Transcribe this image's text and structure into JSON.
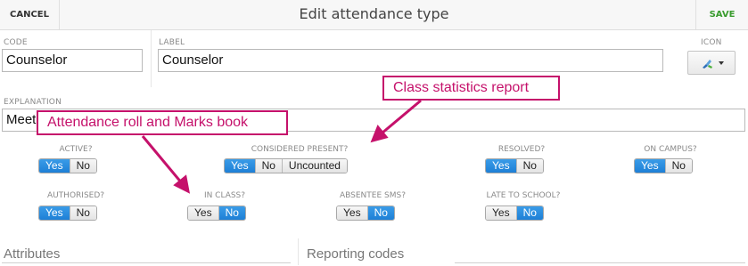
{
  "header": {
    "cancel_label": "CANCEL",
    "title": "Edit attendance type",
    "save_label": "SAVE"
  },
  "form": {
    "code": {
      "label": "CODE",
      "value": "Counselor"
    },
    "label_field": {
      "label": "LABEL",
      "value": "Counselor"
    },
    "icon": {
      "label": "ICON",
      "icon_name": "paint-tool-icon"
    },
    "explanation": {
      "label": "EXPLANATION",
      "value": "Meeti"
    }
  },
  "toggles": {
    "active": {
      "label": "ACTIVE?",
      "options": [
        "Yes",
        "No"
      ],
      "selected": "Yes"
    },
    "considered_present": {
      "label": "CONSIDERED PRESENT?",
      "options": [
        "Yes",
        "No",
        "Uncounted"
      ],
      "selected": "Yes"
    },
    "resolved": {
      "label": "RESOLVED?",
      "options": [
        "Yes",
        "No"
      ],
      "selected": "Yes"
    },
    "on_campus": {
      "label": "ON CAMPUS?",
      "options": [
        "Yes",
        "No"
      ],
      "selected": "Yes"
    },
    "authorised": {
      "label": "AUTHORISED?",
      "options": [
        "Yes",
        "No"
      ],
      "selected": "Yes"
    },
    "in_class": {
      "label": "IN CLASS?",
      "options": [
        "Yes",
        "No"
      ],
      "selected": "No"
    },
    "absentee_sms": {
      "label": "ABSENTEE SMS?",
      "options": [
        "Yes",
        "No"
      ],
      "selected": "No"
    },
    "late_to_school": {
      "label": "LATE TO SCHOOL?",
      "options": [
        "Yes",
        "No"
      ],
      "selected": "No"
    }
  },
  "callouts": {
    "class_stats": "Class statistics report",
    "attendance_roll": "Attendance roll and Marks book"
  },
  "sections": {
    "attributes": "Attributes",
    "reporting_codes": "Reporting codes"
  },
  "colors": {
    "accent_blue": "#1d7fd6",
    "save_green": "#3a9c2f",
    "callout_magenta": "#c5116b"
  }
}
